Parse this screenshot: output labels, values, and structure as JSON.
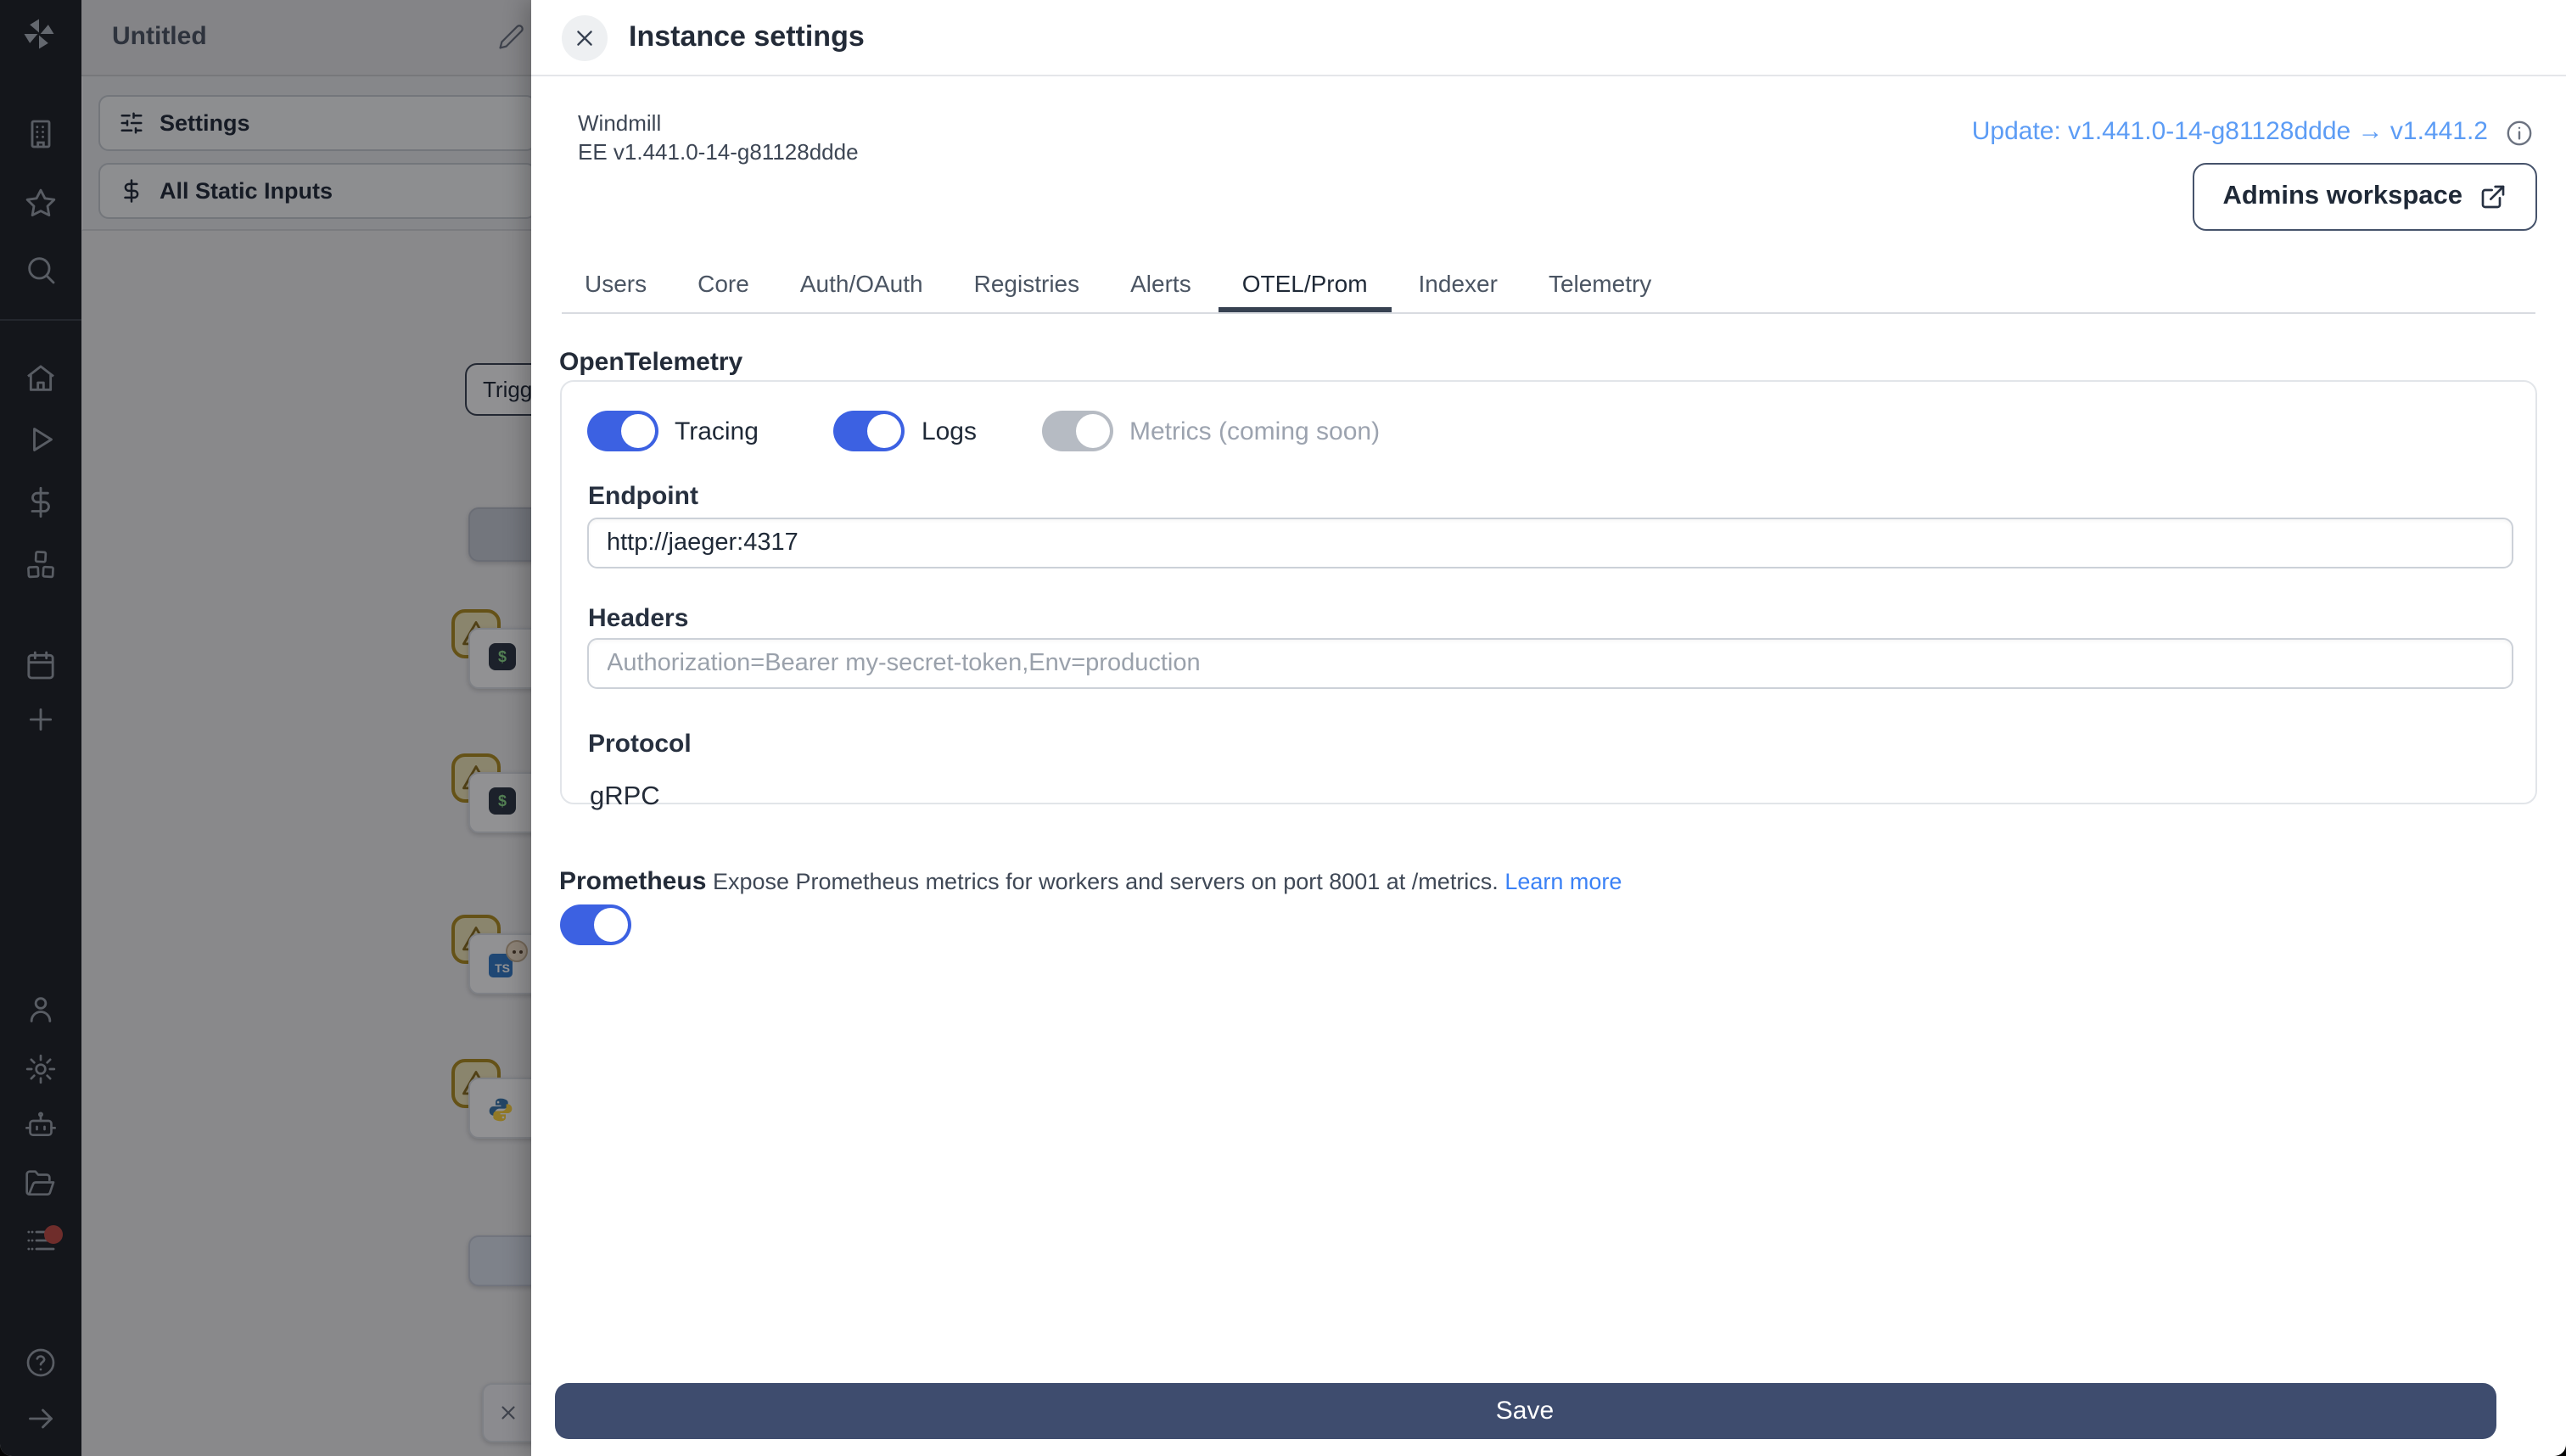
{
  "backdrop": {
    "flow_name": "Untitled",
    "settings_button": "Settings",
    "static_inputs_button": "All Static Inputs",
    "trigger_button": "Trigg",
    "ts_label": "TS",
    "bash_glyph": "$"
  },
  "drawer": {
    "title": "Instance settings",
    "app": "Windmill",
    "version": "EE v1.441.0-14-g81128ddde",
    "update_link": "Update: v1.441.0-14-g81128ddde → v1.441.2",
    "workspace_button": "Admins workspace",
    "tabs": [
      {
        "label": "Users"
      },
      {
        "label": "Core"
      },
      {
        "label": "Auth/OAuth"
      },
      {
        "label": "Registries"
      },
      {
        "label": "Alerts"
      },
      {
        "label": "OTEL/Prom",
        "active": true
      },
      {
        "label": "Indexer"
      },
      {
        "label": "Telemetry"
      }
    ],
    "otel": {
      "heading": "OpenTelemetry",
      "toggles": [
        {
          "label": "Tracing",
          "state": "on"
        },
        {
          "label": "Logs",
          "state": "on"
        },
        {
          "label": "Metrics (coming soon)",
          "state": "disabled"
        }
      ],
      "endpoint_label": "Endpoint",
      "endpoint_value": "http://jaeger:4317",
      "headers_label": "Headers",
      "headers_placeholder": "Authorization=Bearer my-secret-token,Env=production",
      "protocol_label": "Protocol",
      "protocol_value": "gRPC"
    },
    "prometheus": {
      "heading": "Prometheus",
      "description": "Expose Prometheus metrics for workers and servers on port 8001 at /metrics.",
      "learn_more": "Learn more",
      "enabled": true
    },
    "save_button": "Save"
  },
  "colors": {
    "toggle_blue": "#3c61e2",
    "link_blue": "#5c9cf5",
    "learn_more_blue": "#3b82f6",
    "save_navy": "#3e4c6e",
    "sidebar_dark": "#1d2026"
  }
}
